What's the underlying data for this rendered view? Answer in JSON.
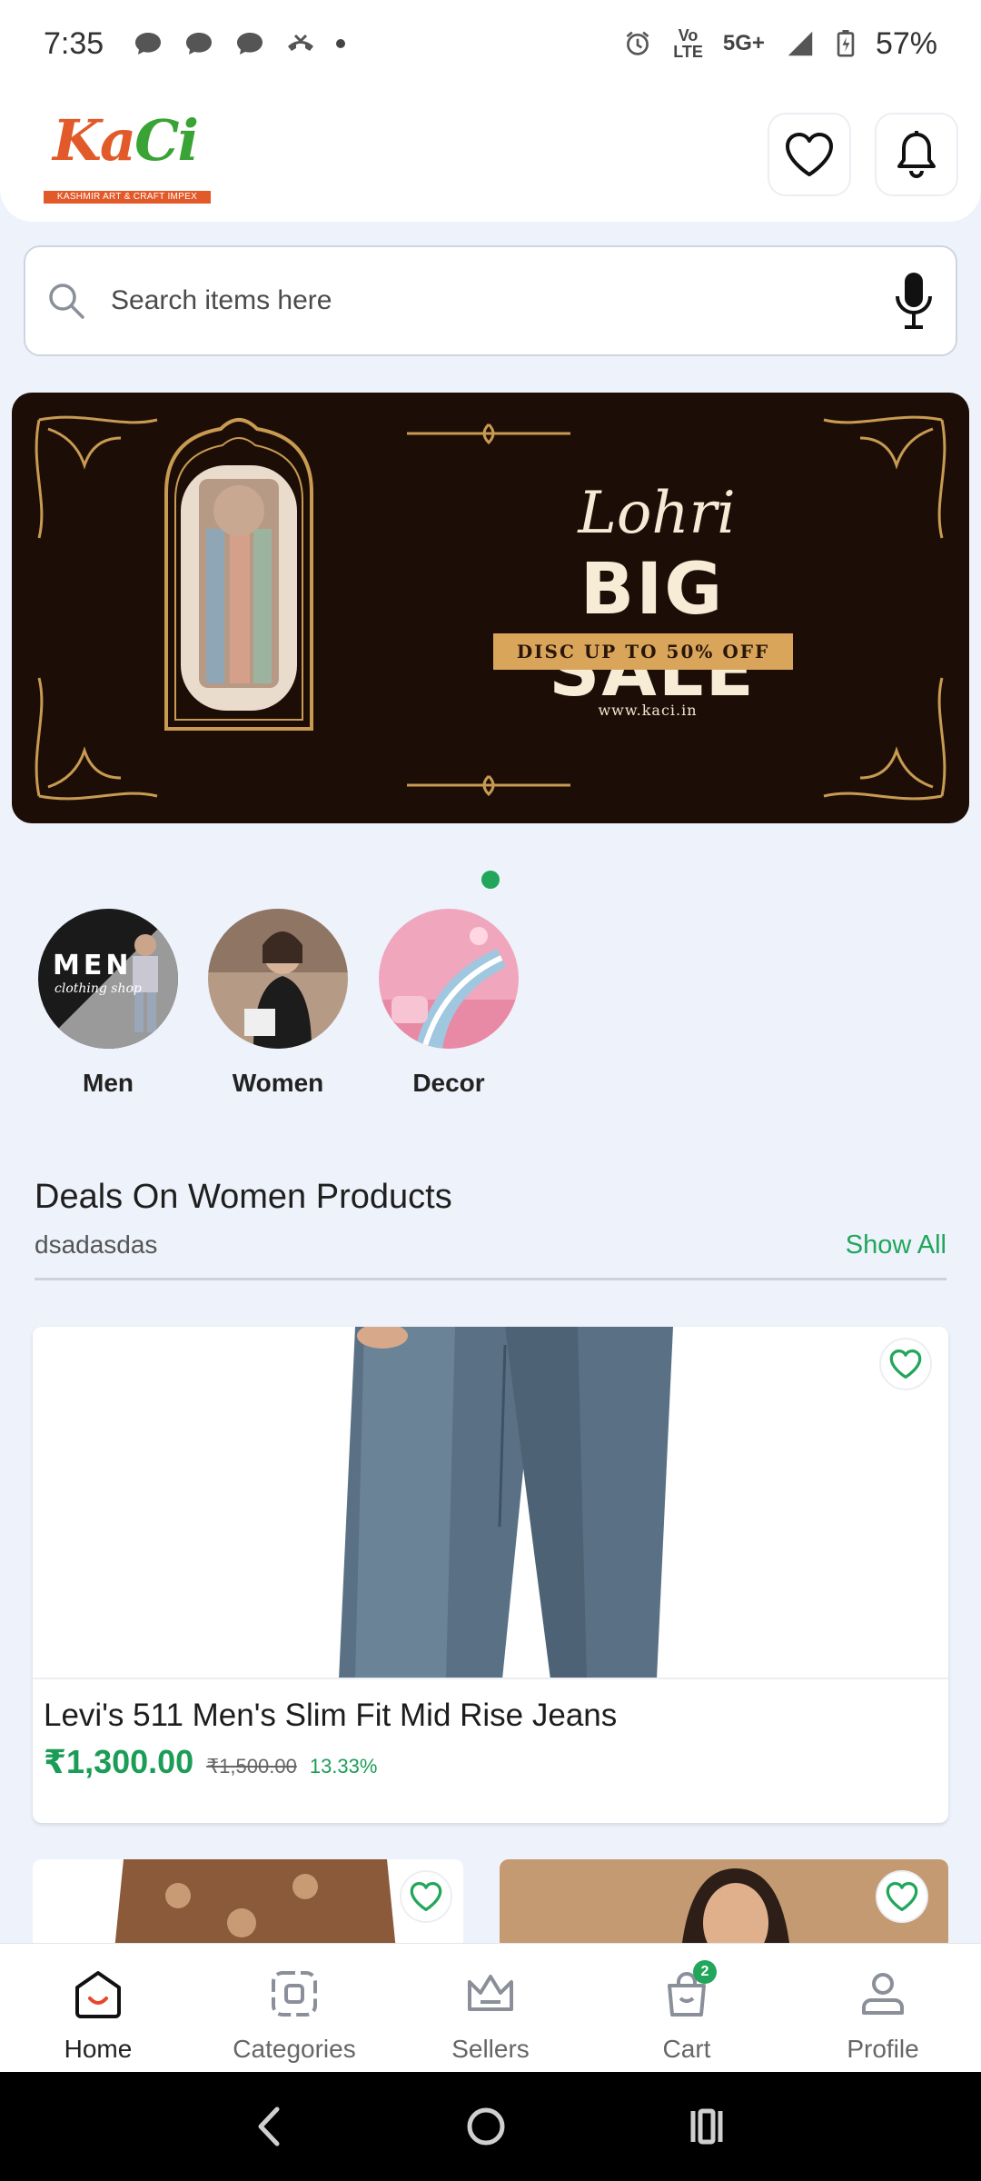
{
  "status_bar": {
    "time": "7:35",
    "network_top": "Vo",
    "network_bottom": "LTE",
    "signal_label": "5G+",
    "battery": "57%"
  },
  "header": {
    "logo_text": "KaCi",
    "logo_tagline": "KASHMIR ART & CRAFT IMPEX"
  },
  "search": {
    "placeholder": "Search items here"
  },
  "banner": {
    "script_title": "Lohri",
    "title": "BIG SALE",
    "discount": "DISC UP TO 50% OFF",
    "url": "www.kaci.in"
  },
  "categories": [
    {
      "label": "Men",
      "image_text": "MEN",
      "image_subtext": "clothing shop"
    },
    {
      "label": "Women"
    },
    {
      "label": "Decor"
    }
  ],
  "section": {
    "title": "Deals On Women Products",
    "subtitle": "dsadasdas",
    "show_all": "Show All"
  },
  "product": {
    "name": "Levi's 511 Men's Slim Fit Mid Rise Jeans",
    "price": "₹1,300.00",
    "mrp": "₹1,500.00",
    "discount": "13.33%"
  },
  "bottom_nav": {
    "items": [
      {
        "label": "Home"
      },
      {
        "label": "Categories"
      },
      {
        "label": "Sellers"
      },
      {
        "label": "Cart",
        "badge": "2"
      },
      {
        "label": "Profile"
      }
    ]
  },
  "colors": {
    "accent_green": "#21a65b",
    "background": "#eef2fb",
    "banner_bg": "#1c0e06",
    "logo_orange": "#e35a2a"
  }
}
